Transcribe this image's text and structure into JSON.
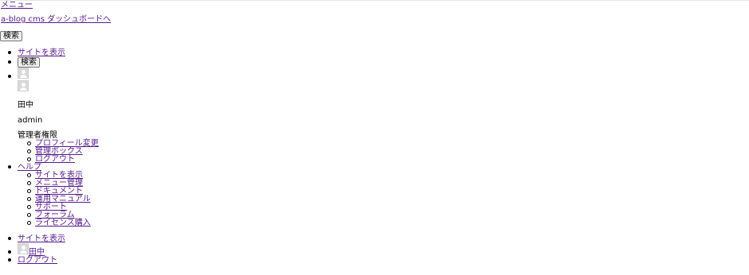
{
  "top": {
    "menu_label": "メニュー",
    "dashboard_label": "a-blog cms ダッシュボードへ",
    "search_label": "検索"
  },
  "main_nav": {
    "view_site": "サイトを表示",
    "search_label": "検索",
    "user": {
      "name": "田中",
      "id": "admin",
      "role": "管理者権限",
      "links": [
        "プロフィール変更",
        "管理ボックス",
        "ログアウト"
      ]
    },
    "help": {
      "label": "ヘルプ",
      "links": [
        "サイトを表示",
        "メニュー管理",
        "ドキュメント",
        "運用マニュアル",
        "サポート",
        "フォーラム",
        "ライセンス購入"
      ]
    }
  },
  "bottom_nav": {
    "view_site": "サイトを表示",
    "user_name": "田中",
    "logout": "ログアウト"
  }
}
